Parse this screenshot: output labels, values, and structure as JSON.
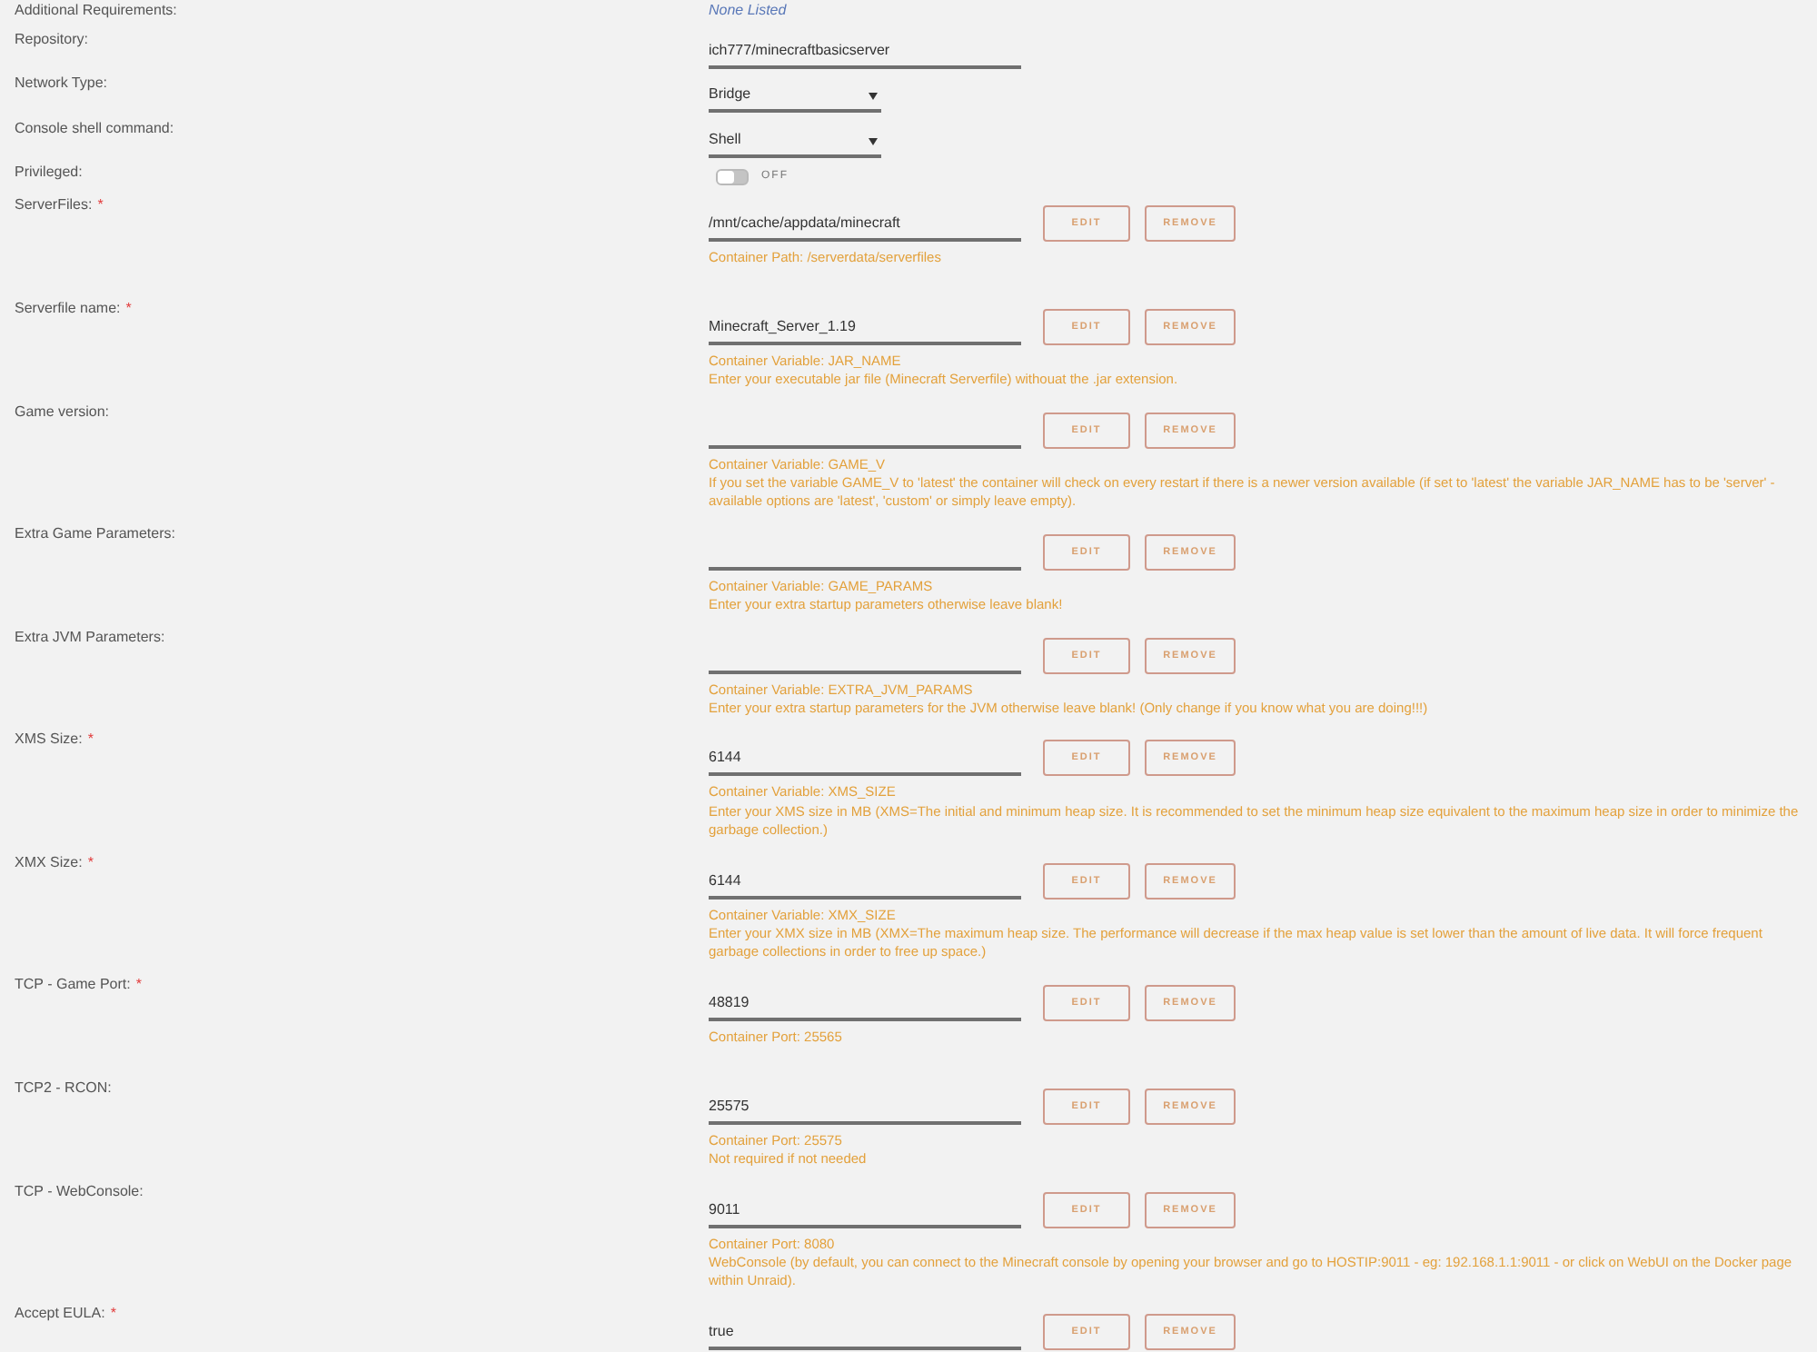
{
  "fields": [
    {
      "kind": "info",
      "label": "Additional Requirements:",
      "value": "None Listed"
    },
    {
      "kind": "text",
      "label": "Repository:",
      "value": "ich777/minecraftbasicserver"
    },
    {
      "kind": "select",
      "label": "Network Type:",
      "value": "Bridge"
    },
    {
      "kind": "select",
      "label": "Console shell command:",
      "value": "Shell"
    },
    {
      "kind": "toggle",
      "label": "Privileged:",
      "on": false,
      "state_text": "OFF"
    },
    {
      "kind": "variable",
      "label": "ServerFiles:",
      "required_mark": "*",
      "value": "/mnt/cache/appdata/minecraft",
      "buttons": [
        "EDIT",
        "REMOVE"
      ],
      "notes": [
        "Container Path: /serverdata/serverfiles"
      ]
    },
    {
      "kind": "variable",
      "label": "Serverfile name:",
      "required_mark": "*",
      "value": "Minecraft_Server_1.19",
      "buttons": [
        "EDIT",
        "REMOVE"
      ],
      "notes": [
        "Container Variable: JAR_NAME",
        "Enter your executable jar file (Minecraft Serverfile) withouat the .jar extension."
      ]
    },
    {
      "kind": "variable",
      "label": "Game version:",
      "buttons": [
        "EDIT",
        "REMOVE"
      ],
      "notes": [
        "Container Variable: GAME_V",
        "If you set the variable GAME_V to 'latest' the container will check on every restart if there is a newer version available (if set to 'latest' the variable JAR_NAME has to be 'server' - available options are 'latest', 'custom' or simply leave empty)."
      ]
    },
    {
      "kind": "variable",
      "label": "Extra Game Parameters:",
      "buttons": [
        "EDIT",
        "REMOVE"
      ],
      "notes": [
        "Container Variable: GAME_PARAMS",
        "Enter your extra startup parameters otherwise leave blank!"
      ]
    },
    {
      "kind": "variable",
      "label": "Extra JVM Parameters:",
      "buttons": [
        "EDIT",
        "REMOVE"
      ],
      "notes": [
        "Container Variable: EXTRA_JVM_PARAMS",
        "Enter your extra startup parameters for the JVM otherwise leave blank! (Only change if you know what you are doing!!!)"
      ]
    },
    {
      "kind": "variable",
      "label": "XMS Size:",
      "required_mark": "*",
      "value": "6144",
      "buttons": [
        "EDIT",
        "REMOVE"
      ],
      "notes": [
        "Container Variable: XMS_SIZE",
        "Enter your XMS size in MB (XMS=The initial and minimum heap size. It is recommended to set the minimum heap size equivalent to the maximum heap size in order to minimize the garbage collection.)"
      ]
    },
    {
      "kind": "variable",
      "label": "XMX Size:",
      "required_mark": "*",
      "value": "6144",
      "buttons": [
        "EDIT",
        "REMOVE"
      ],
      "notes": [
        "Container Variable: XMX_SIZE",
        "Enter your XMX size in MB (XMX=The maximum heap size. The performance will decrease if the max heap value is set lower than the amount of live data. It will force frequent garbage collections in order to free up space.)"
      ]
    },
    {
      "kind": "variable",
      "label": "TCP - Game Port:",
      "required_mark": "*",
      "value": "48819",
      "buttons": [
        "EDIT",
        "REMOVE"
      ],
      "notes": [
        "Container Port: 25565"
      ]
    },
    {
      "kind": "variable",
      "label": "TCP2 - RCON:",
      "value": "25575",
      "buttons": [
        "EDIT",
        "REMOVE"
      ],
      "notes": [
        "Container Port: 25575",
        "Not required if not needed"
      ]
    },
    {
      "kind": "variable",
      "label": "TCP - WebConsole:",
      "value": "9011",
      "buttons": [
        "EDIT",
        "REMOVE"
      ],
      "notes": [
        "Container Port: 8080",
        "WebConsole (by default, you can connect to the Minecraft console by opening your browser and go to HOSTIP:9011 - eg: 192.168.1.1:9011 - or click on WebUI on the Docker page within Unraid)."
      ]
    },
    {
      "kind": "variable",
      "label": "Accept EULA:",
      "required_mark": "*",
      "value": "true",
      "buttons": [
        "EDIT",
        "REMOVE"
      ]
    }
  ]
}
